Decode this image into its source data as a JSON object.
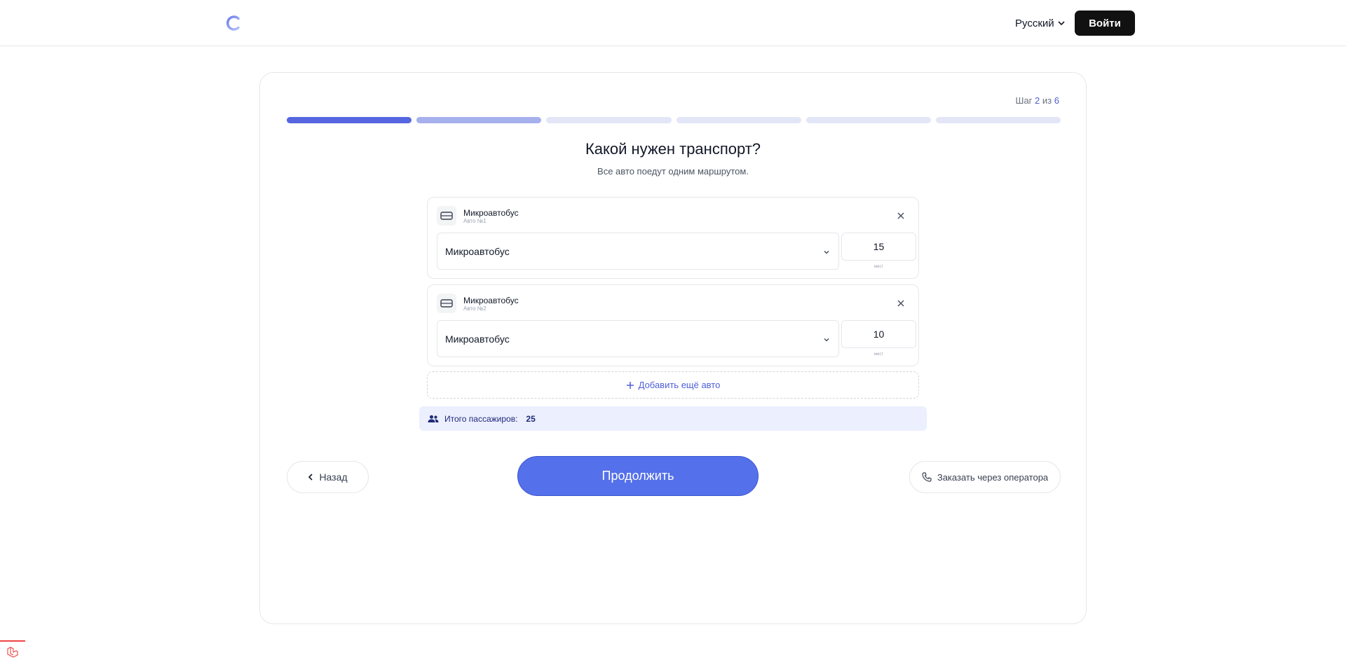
{
  "header": {
    "language": "Русский",
    "login_label": "Войти"
  },
  "progress": {
    "step_prefix": "Шаг",
    "current_step": "2",
    "of_label": "из",
    "total_steps": "6",
    "segments": [
      "done",
      "partial",
      "todo",
      "todo",
      "todo",
      "todo"
    ]
  },
  "main": {
    "title": "Какой нужен транспорт?",
    "subtitle": "Все авто поедут одним маршрутом."
  },
  "vehicles": [
    {
      "name": "Микроавтобус",
      "sub": "Авто №1",
      "type_value": "Микроавтобус",
      "seats": "15",
      "seats_label": "мест"
    },
    {
      "name": "Микроавтобус",
      "sub": "Авто №2",
      "type_value": "Микроавтобус",
      "seats": "10",
      "seats_label": "мест"
    }
  ],
  "add_car_label": "Добавить ещё авто",
  "totals": {
    "label": "Итого пассажиров:",
    "count": "25"
  },
  "nav": {
    "back_label": "Назад",
    "continue_label": "Продолжить",
    "operator_label": "Заказать через оператора"
  },
  "colors": {
    "accent": "#5470ea",
    "progress_done": "#5566e0",
    "progress_partial": "#a6b0ec",
    "progress_todo": "#e3e6f7",
    "totals_bg": "#eceffd"
  }
}
